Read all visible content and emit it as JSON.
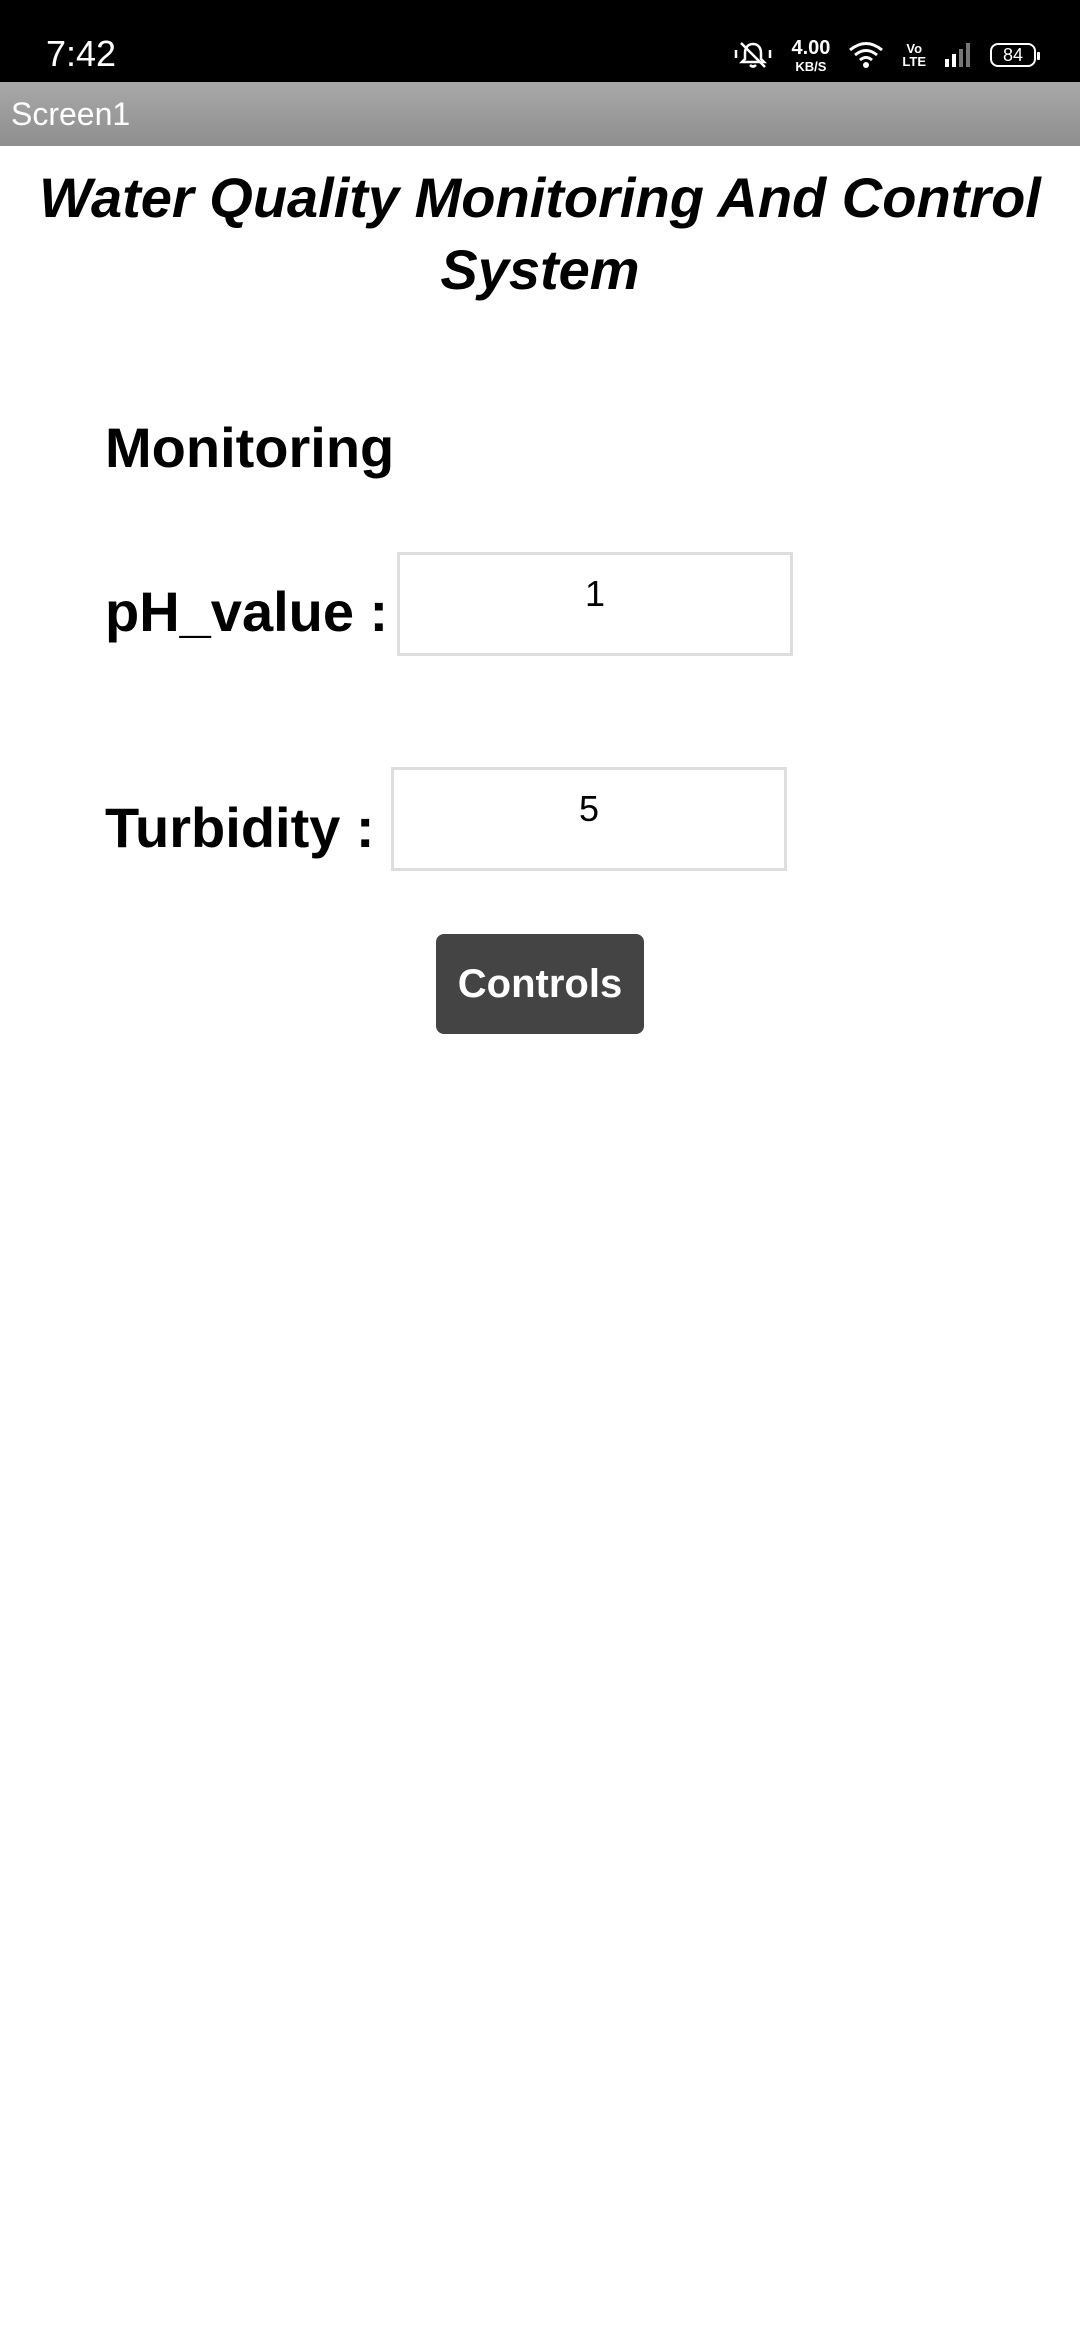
{
  "status_bar": {
    "time": "7:42",
    "net_speed_value": "4.00",
    "net_speed_unit": "KB/S",
    "volte_top": "Vo",
    "volte_bottom": "LTE",
    "battery": "84",
    "icons": [
      "mute-vibrate-icon",
      "wifi-icon",
      "signal-icon",
      "battery-icon"
    ]
  },
  "app_bar": {
    "title": "Screen1"
  },
  "page": {
    "title": "Water Quality Monitoring And Control System",
    "section_heading": "Monitoring",
    "fields": [
      {
        "label": "pH_value :",
        "value": "1"
      },
      {
        "label": "Turbidity :",
        "value": "5"
      }
    ],
    "controls_button_label": "Controls"
  },
  "colors": {
    "status_bar_bg": "#000000",
    "app_bar_bg": "#9a9a9a",
    "button_bg": "#444444",
    "field_border": "#dedede"
  }
}
